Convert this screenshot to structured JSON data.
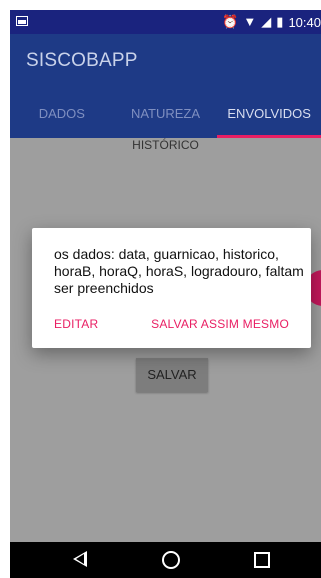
{
  "statusbar": {
    "time": "10:40",
    "icons": [
      "image-icon",
      "alarm-icon",
      "wifi-icon",
      "signal-icon",
      "battery-icon"
    ]
  },
  "appbar": {
    "title": "SISCOBAPP"
  },
  "tabs": [
    {
      "label": "DADOS",
      "active": false
    },
    {
      "label": "NATUREZA",
      "active": false
    },
    {
      "label": "ENVOLVIDOS",
      "active": true
    }
  ],
  "content": {
    "historico_label": "HISTÓRICO",
    "save_label": "SALVAR"
  },
  "dialog": {
    "message": "os dados: data, guarnicao, historico, horaB, horaQ, horaS, logradouro, faltam ser preenchidos",
    "edit_label": "EDITAR",
    "save_anyway_label": "SALVAR ASSIM MESMO"
  },
  "colors": {
    "primary": "#1e3a86",
    "statusbar": "#1a237e",
    "accent": "#e91e63",
    "scrim_content": "#9e9e9e"
  }
}
